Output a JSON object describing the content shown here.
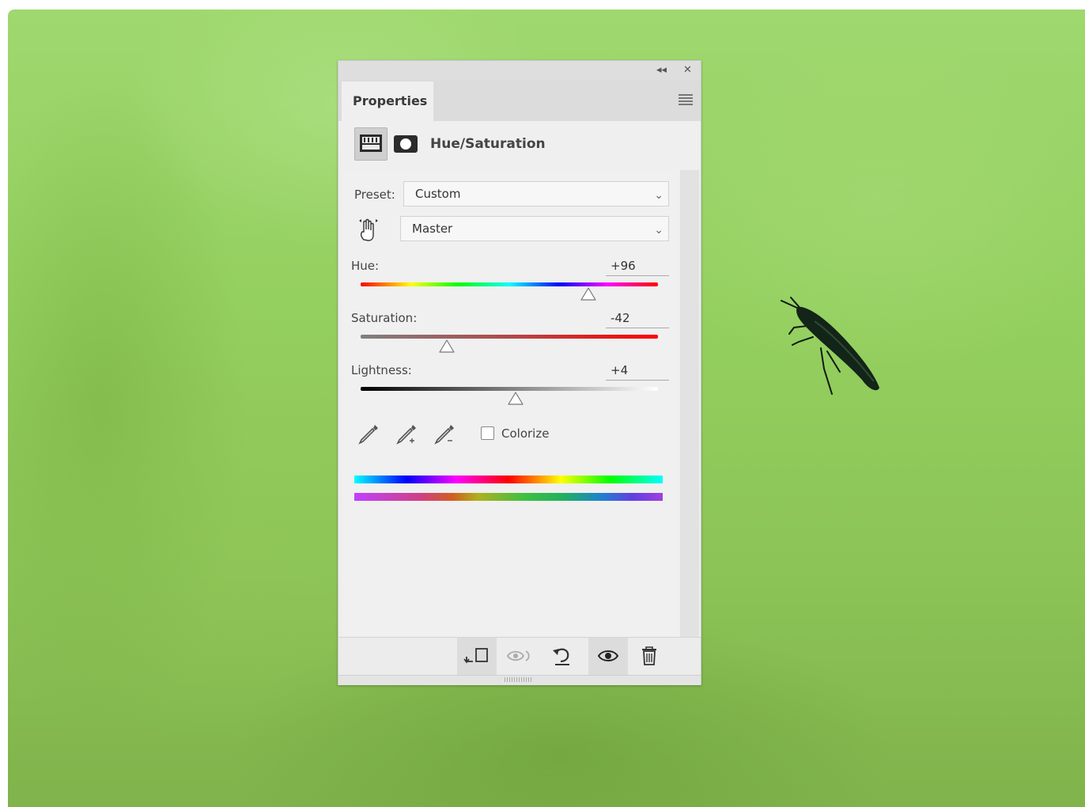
{
  "panel": {
    "tab_label": "Properties",
    "adjustment_title": "Hue/Saturation",
    "preset_label": "Preset:",
    "preset_value": "Custom",
    "channel_value": "Master",
    "hue": {
      "label": "Hue:",
      "value": "+96",
      "level": 0.767
    },
    "saturation": {
      "label": "Saturation:",
      "value": "-42",
      "level": 0.29
    },
    "lightness": {
      "label": "Lightness:",
      "value": "+4",
      "level": 0.52
    },
    "colorize_label": "Colorize",
    "colorize_checked": false
  },
  "icons": {
    "collapse": "double-chevron-left-icon",
    "close": "close-icon",
    "menu": "hamburger-menu-icon",
    "adjustment_layer": "adjustment-layer-icon",
    "mask": "layer-mask-icon",
    "targeted_adjustment": "hand-pointer-icon",
    "eyedroppers": [
      "eyedropper-icon",
      "eyedropper-add-icon",
      "eyedropper-subtract-icon"
    ],
    "footer": [
      "clip-to-layer-icon",
      "view-previous-state-icon",
      "reset-icon",
      "visibility-eye-icon",
      "trash-icon"
    ]
  },
  "colors": {
    "background_green": "#93cf5f",
    "panel_bg": "#efefef"
  }
}
